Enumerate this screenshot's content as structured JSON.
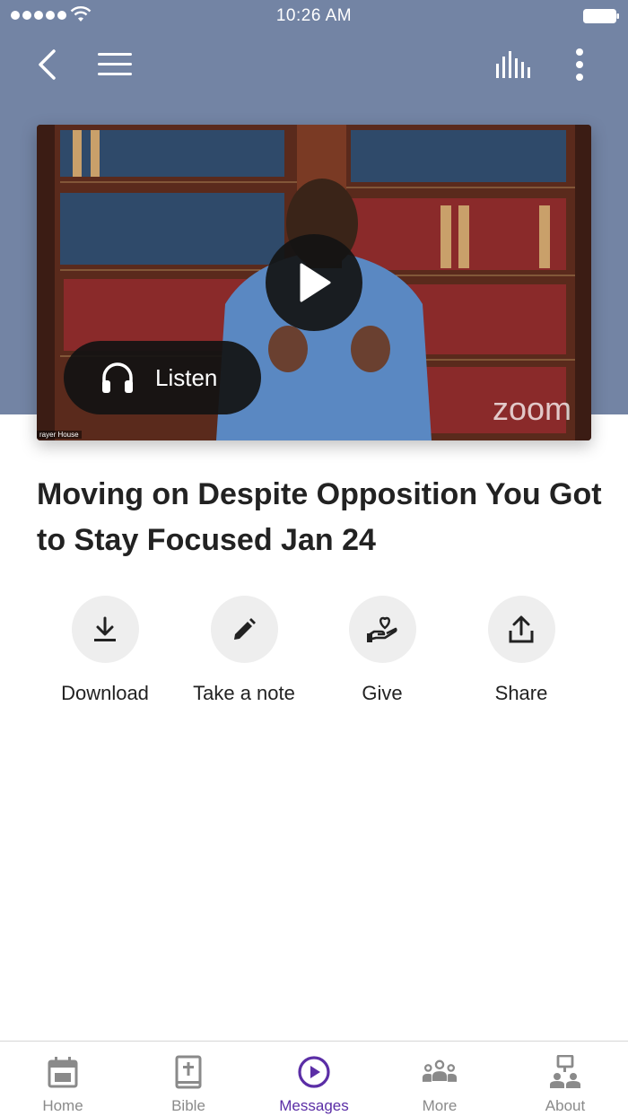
{
  "status_bar": {
    "time": "10:26 AM"
  },
  "nav": {
    "back_icon": "chevron-left-icon",
    "menu_icon": "hamburger-icon",
    "bars_icon": "audio-bars-icon",
    "more_icon": "kebab-icon"
  },
  "media": {
    "listen_label": "Listen",
    "watermark": "zoom",
    "corner_tag": "rayer House"
  },
  "message": {
    "title": "Moving on Despite Opposition You Got to Stay Focused Jan 24"
  },
  "actions": [
    {
      "label": "Download",
      "icon": "download-icon"
    },
    {
      "label": "Take a note",
      "icon": "pencil-icon"
    },
    {
      "label": "Give",
      "icon": "give-icon"
    },
    {
      "label": "Share",
      "icon": "share-icon"
    }
  ],
  "tabs": [
    {
      "label": "Home",
      "icon": "calendar-icon"
    },
    {
      "label": "Bible",
      "icon": "bible-icon"
    },
    {
      "label": "Messages",
      "icon": "play-circle-icon",
      "active": true
    },
    {
      "label": "More",
      "icon": "people-icon"
    },
    {
      "label": "About",
      "icon": "org-icon"
    }
  ],
  "colors": {
    "hero": "#7384a4",
    "accent": "#5b2ea6",
    "inactive": "#8a8a8a"
  }
}
